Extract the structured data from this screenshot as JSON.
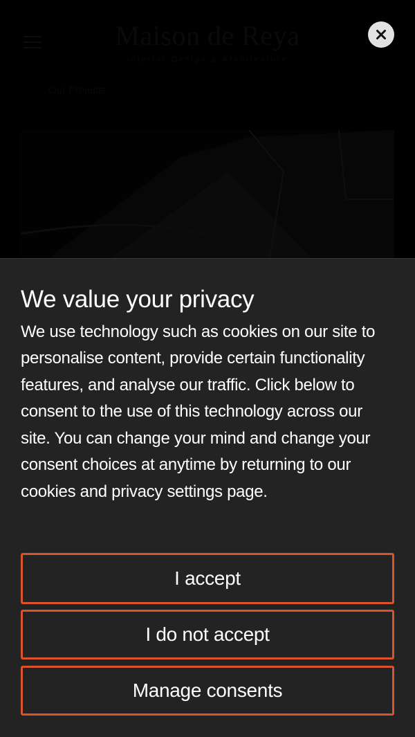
{
  "site": {
    "brand": "Maison de Reya",
    "tagline": "Interior Design & Architecture",
    "breadcrumb": "Our Projects"
  },
  "close": {
    "label": "×",
    "icon": "close-icon"
  },
  "consent": {
    "title": "We value your privacy",
    "body": "We use technology such as cookies on our site to personalise content, provide certain functionality features, and analyse our traffic. Click below to consent to the use of this technology across our site. You can change your mind and change your consent choices at anytime by returning to our cookies and privacy settings page.",
    "accept_label": "I accept",
    "decline_label": "I do not accept",
    "manage_label": "Manage consents"
  },
  "colors": {
    "panel_bg": "#232323",
    "button_border": "#d9532c",
    "text": "#ffffff",
    "close_bg": "#e2e2e2"
  }
}
